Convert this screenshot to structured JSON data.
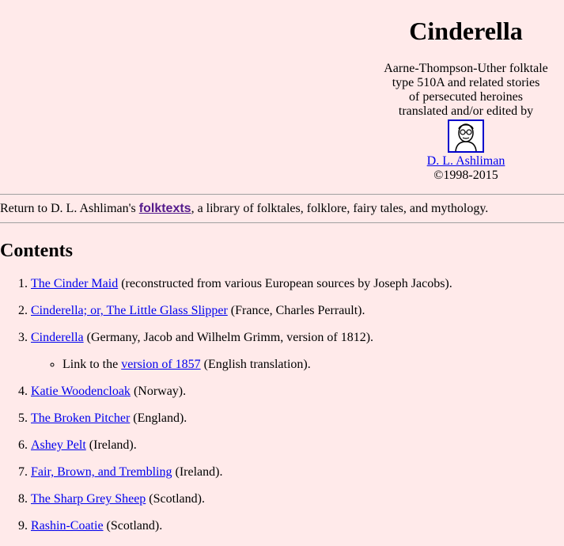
{
  "header": {
    "title": "Cinderella",
    "subtitle_lines": [
      "Aarne-Thompson-Uther folktale",
      "type 510A and related stories",
      "of persecuted heroines",
      "translated and/or edited by"
    ],
    "author_link": "D. L. Ashliman",
    "copyright": "©1998-2015"
  },
  "return_line": {
    "prefix": "Return to D. L. Ashliman's ",
    "link": "folktexts",
    "suffix": ", a library of folktales, folklore, fairy tales, and mythology."
  },
  "contents": {
    "heading": "Contents",
    "items": [
      {
        "number": "1.",
        "link": "The Cinder Maid",
        "note": " (reconstructed from various European sources by Joseph Jacobs)."
      },
      {
        "number": "2.",
        "link": "Cinderella; or, The Little Glass Slipper",
        "note": " (France, Charles Perrault)."
      },
      {
        "number": "3.",
        "link": "Cinderella",
        "note": " (Germany, Jacob and Wilhelm Grimm, version of 1812).",
        "sub": {
          "prefix": "Link to the ",
          "link": "version of 1857",
          "suffix": " (English translation)."
        }
      },
      {
        "number": "4.",
        "link": "Katie Woodencloak",
        "note": " (Norway)."
      },
      {
        "number": "5.",
        "link": "The Broken Pitcher",
        "note": " (England)."
      },
      {
        "number": "6.",
        "link": "Ashey Pelt",
        "note": " (Ireland)."
      },
      {
        "number": "7.",
        "link": "Fair, Brown, and Trembling",
        "note": " (Ireland)."
      },
      {
        "number": "8.",
        "link": "The Sharp Grey Sheep",
        "note": " (Scotland)."
      },
      {
        "number": "9.",
        "link": "Rashin-Coatie",
        "note": " (Scotland)."
      }
    ]
  },
  "colors": {
    "background": "#ffeaea",
    "link": "#0000ee",
    "visited_link": "#551a8b",
    "portrait_border": "#0000cc"
  },
  "icons": {
    "portrait": "author-portrait-icon"
  }
}
